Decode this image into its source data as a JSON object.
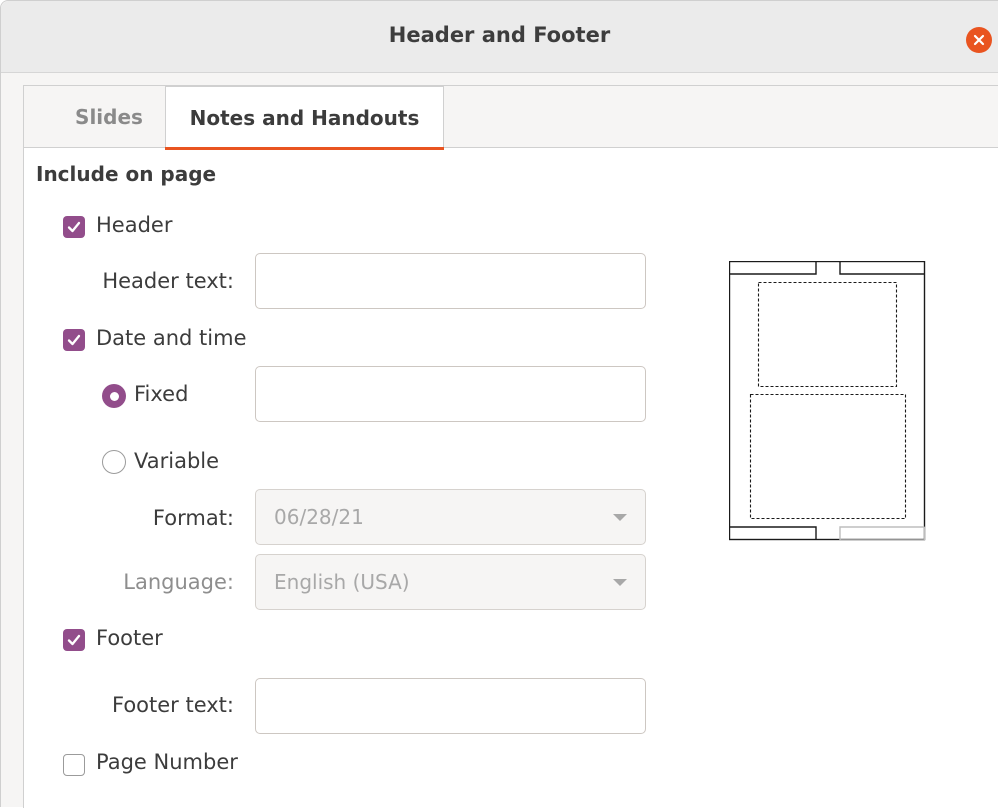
{
  "window": {
    "title": "Header and Footer"
  },
  "tabs": [
    {
      "label": "Slides",
      "active": false
    },
    {
      "label": "Notes and Handouts",
      "active": true
    }
  ],
  "section": {
    "title": "Include on page"
  },
  "header": {
    "checkbox_label": "Header",
    "checked": true,
    "text_label": "Header text:",
    "text_value": ""
  },
  "date_time": {
    "checkbox_label": "Date and time",
    "checked": true,
    "fixed_label": "Fixed",
    "fixed_selected": true,
    "fixed_value": "",
    "variable_label": "Variable",
    "variable_selected": false,
    "format_label": "Format:",
    "format_value": "06/28/21",
    "language_label": "Language:",
    "language_value": "English (USA)"
  },
  "footer": {
    "checkbox_label": "Footer",
    "checked": true,
    "text_label": "Footer text:",
    "text_value": ""
  },
  "page_number": {
    "checkbox_label": "Page Number",
    "checked": false
  },
  "icons": {
    "close": "close-icon",
    "checkmark": "checkmark-icon",
    "dropdown": "chevron-down-icon"
  },
  "colors": {
    "accent": "#e95420",
    "checkbox": "#924d8b"
  }
}
